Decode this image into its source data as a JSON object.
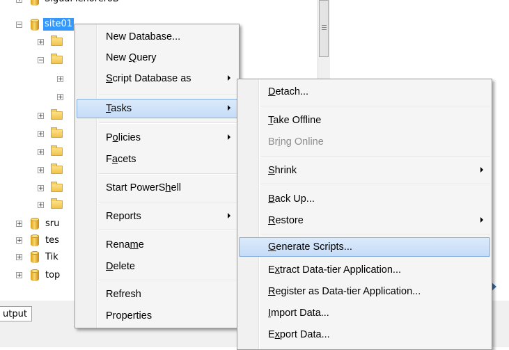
{
  "tree": {
    "top_partial_label": "SiguaMenoreroB",
    "selected_node": "site01",
    "lower_nodes": [
      "sru",
      "tes",
      "Tik",
      "top"
    ]
  },
  "output_tab": "utput",
  "context_menu": {
    "items": [
      {
        "label_parts": [
          "New Database..."
        ],
        "underline": ""
      },
      {
        "label_parts": [
          "New ",
          "Q",
          "uery"
        ]
      },
      {
        "label_parts": [
          "S",
          "cript Database as"
        ]
      },
      {
        "label_parts": [
          "T",
          "asks"
        ]
      },
      {
        "label_parts": [
          "P",
          "o",
          "licies"
        ]
      },
      {
        "label_parts": [
          "F",
          "a",
          "cets"
        ]
      },
      {
        "label_parts": [
          "Start PowerS",
          "h",
          "ell"
        ]
      },
      {
        "label_parts": [
          "Reports"
        ]
      },
      {
        "label_parts": [
          "Rena",
          "m",
          "e"
        ]
      },
      {
        "label_parts": [
          "D",
          "elete"
        ]
      },
      {
        "label_parts": [
          "Refresh"
        ]
      },
      {
        "label_parts": [
          "Properties"
        ]
      }
    ]
  },
  "tasks_menu": {
    "items": [
      {
        "label_parts": [
          "D",
          "etach..."
        ]
      },
      {
        "label_parts": [
          "T",
          "ake Offline"
        ]
      },
      {
        "label_parts": [
          "Br",
          "i",
          "ng Online"
        ]
      },
      {
        "label_parts": [
          "S",
          "hrink"
        ]
      },
      {
        "label_parts": [
          "B",
          "ack Up..."
        ]
      },
      {
        "label_parts": [
          "R",
          "estore"
        ]
      },
      {
        "label_parts": [
          "G",
          "enerate Scripts..."
        ]
      },
      {
        "label_parts": [
          "E",
          "x",
          "tract Data-tier Application..."
        ]
      },
      {
        "label_parts": [
          "R",
          "egister as Data-tier Application..."
        ]
      },
      {
        "label_parts": [
          "I",
          "mport Data..."
        ]
      },
      {
        "label_parts": [
          "E",
          "x",
          "port Data..."
        ]
      }
    ]
  },
  "colors": {
    "selection": "#3399ff",
    "menu_highlight": "#c5dcf7",
    "menu_bg": "#f5f5f5"
  }
}
